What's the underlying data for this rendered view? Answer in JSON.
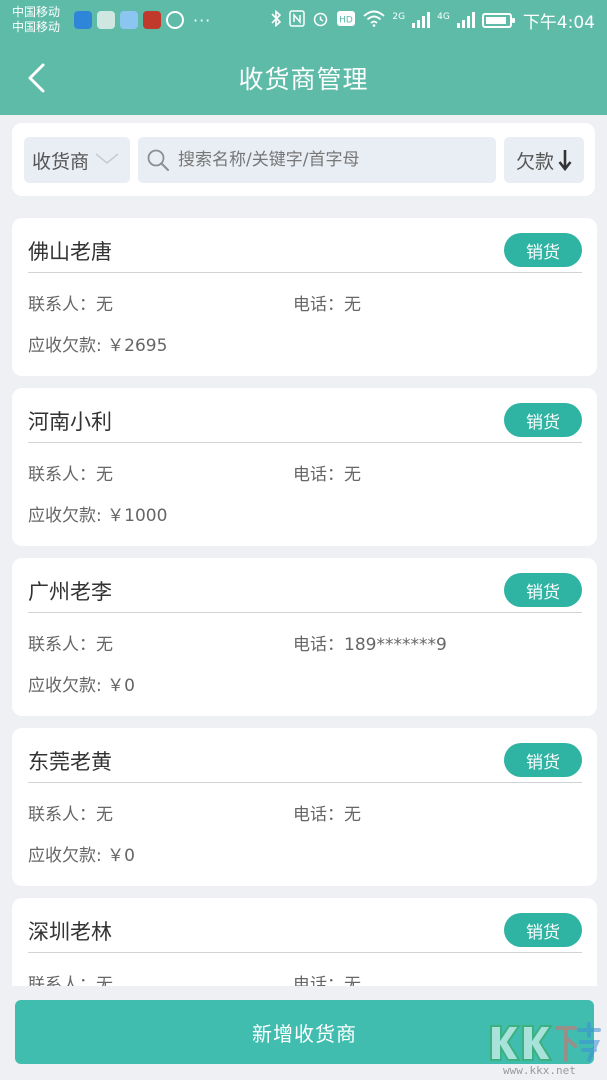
{
  "status_bar": {
    "carrier_1": "中国移动",
    "carrier_2": "中国移动",
    "more": "···",
    "network_1": "2G",
    "network_2": "4G",
    "time": "下午4:04"
  },
  "header": {
    "title": "收货商管理"
  },
  "filter": {
    "type_label": "收货商",
    "search_placeholder": "搜索名称/关键字/首字母",
    "sort_label": "欠款"
  },
  "list": {
    "items": [
      {
        "name": "佛山老唐",
        "action": "销货",
        "contact": "联系人：无",
        "phone": "电话：无",
        "debt": "应收欠款: ￥2695"
      },
      {
        "name": "河南小利",
        "action": "销货",
        "contact": "联系人：无",
        "phone": "电话：无",
        "debt": "应收欠款: ￥1000"
      },
      {
        "name": "广州老李",
        "action": "销货",
        "contact": "联系人：无",
        "phone": "电话：189*******9",
        "debt": "应收欠款: ￥0"
      },
      {
        "name": "东莞老黄",
        "action": "销货",
        "contact": "联系人：无",
        "phone": "电话：无",
        "debt": "应收欠款: ￥0"
      },
      {
        "name": "深圳老林",
        "action": "销货",
        "contact": "联系人：无",
        "phone": "电话：无",
        "debt": ""
      }
    ]
  },
  "footer": {
    "add_label": "新增收货商"
  },
  "watermark": {
    "logo_text": "KK下载",
    "url": "www.kkx.net"
  },
  "colors": {
    "header": "#5dbba8",
    "accent": "#2fb3a3",
    "add_button": "#41bdb0",
    "background": "#eef0f3"
  }
}
